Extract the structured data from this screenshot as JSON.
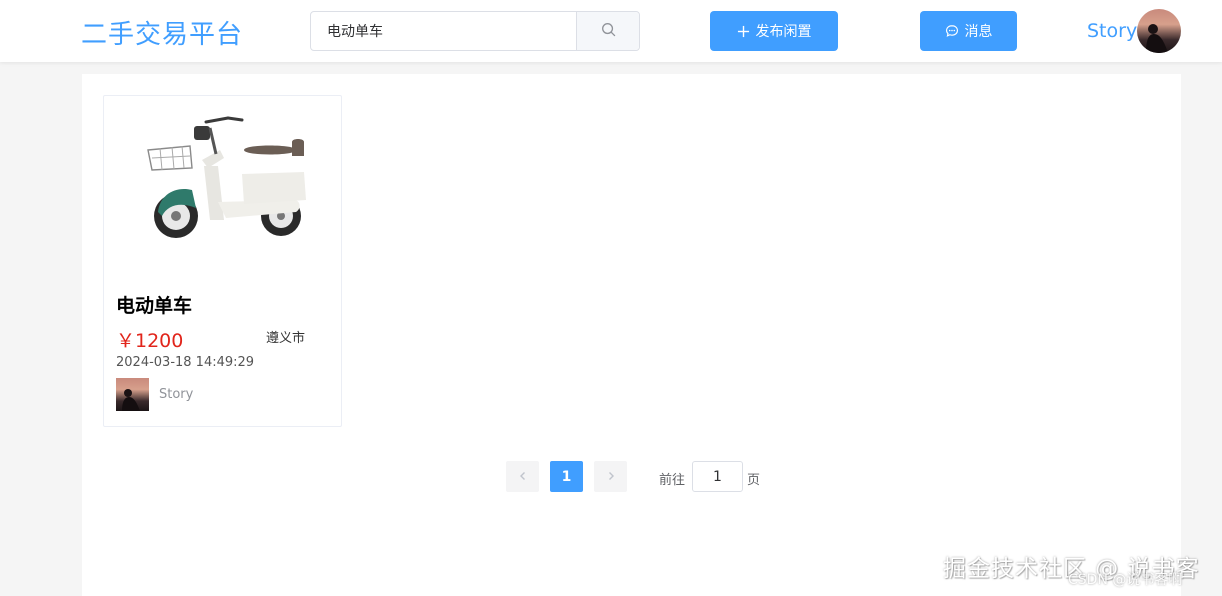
{
  "header": {
    "logo": "二手交易平台",
    "search": {
      "value": "电动单车",
      "placeholder": ""
    },
    "publish_label": "发布闲置",
    "message_label": "消息",
    "username": "Story"
  },
  "products": [
    {
      "title": "电动单车",
      "price": "￥1200",
      "city": "遵义市",
      "time": "2024-03-18 14:49:29",
      "seller": "Story"
    }
  ],
  "pagination": {
    "current_page": "1",
    "goto_label": "前往",
    "goto_value": "1",
    "goto_suffix": "页"
  },
  "watermark": {
    "main": "掘金技术社区 @ 说书客",
    "sub": "CSDN @说书客啊"
  },
  "colors": {
    "primary": "#409eff",
    "price": "#e1251b"
  }
}
